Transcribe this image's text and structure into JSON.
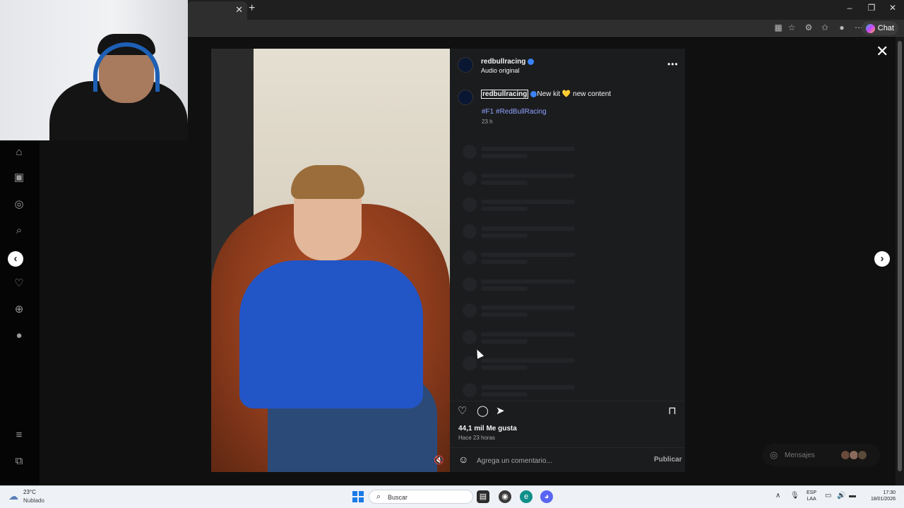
{
  "browser": {
    "tab_close_glyph": "✕",
    "new_tab_glyph": "+",
    "window_controls": {
      "minimize": "–",
      "restore": "❐",
      "close": "✕"
    },
    "chat_label": "Chat"
  },
  "post_view": {
    "close_glyph": "✕",
    "prev_glyph": "‹",
    "next_glyph": "›",
    "header": {
      "username": "redbullracing",
      "subtitle": "Audio original",
      "more_glyph": "•••"
    },
    "caption": {
      "username": "redbullracing",
      "text": "New kit 💛 new content",
      "hashtags": "#F1 #RedBullRacing",
      "time": "23 h"
    },
    "likes": "44,1 mil Me gusta",
    "posted_ago": "Hace 23 horas",
    "comment_placeholder": "Agrega un comentario...",
    "publish_label": "Publicar"
  },
  "messages": {
    "label": "Mensajes"
  },
  "taskbar": {
    "weather_temp": "23°C",
    "weather_desc": "Nublado",
    "search_label": "Buscar",
    "lang_top": "ESP",
    "lang_bottom": "LAA",
    "time": "17:30",
    "date": "18/01/2026"
  },
  "colors": {
    "hashtag": "#8ea2ff",
    "verified": "#3b82f6",
    "panel_bg": "#1b1c1e"
  }
}
